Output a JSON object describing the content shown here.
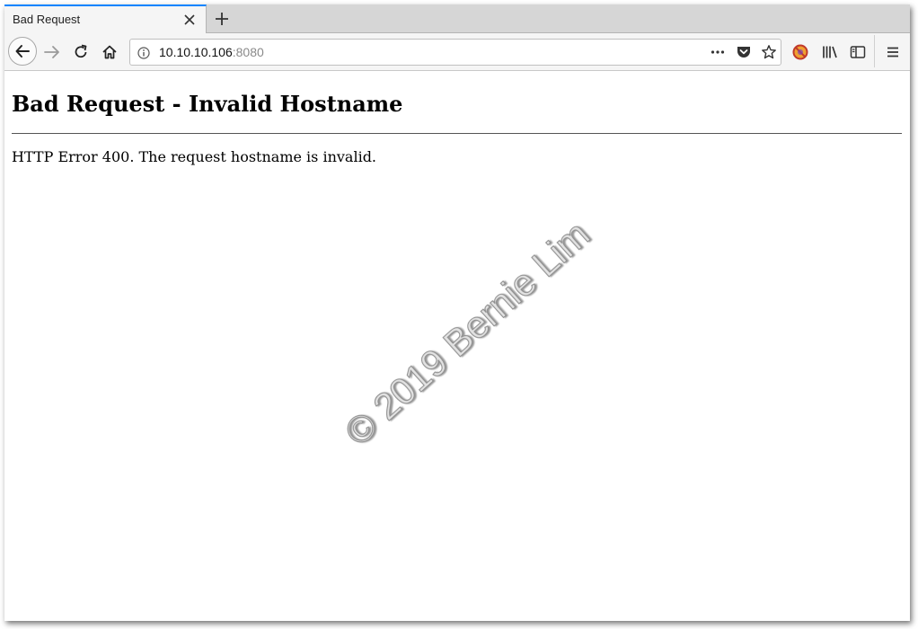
{
  "browser": {
    "tab": {
      "title": "Bad Request"
    },
    "address_bar": {
      "host": "10.10.10.106",
      "port": ":8080"
    },
    "icons": {
      "tab_close": "close-icon",
      "new_tab": "plus-icon",
      "back": "back-arrow-icon",
      "forward": "forward-arrow-icon",
      "reload": "reload-icon",
      "home": "home-icon",
      "site_info": "info-icon",
      "page_actions": "more-horizontal-icon",
      "pocket": "pocket-icon",
      "bookmark": "star-icon",
      "extension": "blocked-extension-icon",
      "library": "library-icon",
      "sidebar": "sidebar-icon",
      "menu": "hamburger-menu-icon"
    }
  },
  "page": {
    "heading": "Bad Request - Invalid Hostname",
    "message": "HTTP Error 400. The request hostname is invalid."
  },
  "watermark": {
    "text": "© 2019 Bernie Lim"
  },
  "colors": {
    "tab_accent": "#0a84ff",
    "chrome_bg": "#d6d6d6",
    "toolbar_bg": "#f5f5f5"
  }
}
